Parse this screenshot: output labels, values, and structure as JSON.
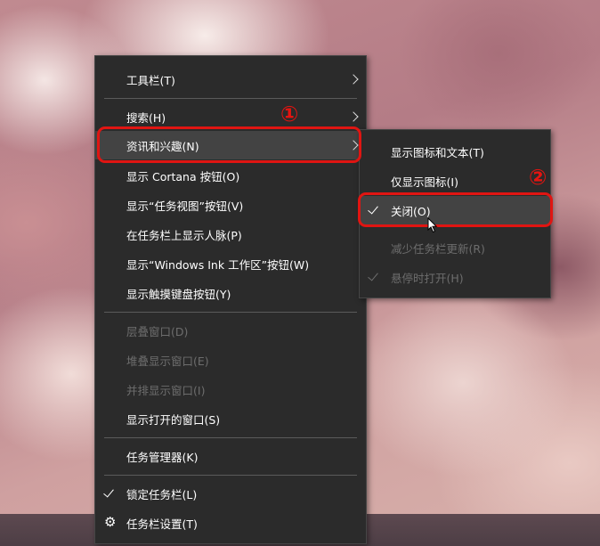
{
  "main_menu": {
    "toolbars": "工具栏(T)",
    "search": "搜索(H)",
    "news_interests": "资讯和兴趣(N)",
    "show_cortana": "显示 Cortana 按钮(O)",
    "show_task_view": "显示“任务视图”按钮(V)",
    "show_people": "在任务栏上显示人脉(P)",
    "show_ink": "显示“Windows Ink 工作区”按钮(W)",
    "show_touch_keyboard": "显示触摸键盘按钮(Y)",
    "cascade": "层叠窗口(D)",
    "stack": "堆叠显示窗口(E)",
    "side_by_side": "并排显示窗口(I)",
    "show_desktop": "显示打开的窗口(S)",
    "task_manager": "任务管理器(K)",
    "lock_taskbar": "锁定任务栏(L)",
    "taskbar_settings": "任务栏设置(T)"
  },
  "sub_menu": {
    "show_icon_text": "显示图标和文本(T)",
    "show_icon_only": "仅显示图标(I)",
    "turn_off": "关闭(O)",
    "reduce_updates": "减少任务栏更新(R)",
    "open_on_hover": "悬停时打开(H)"
  },
  "annotations": {
    "step1": "①",
    "step2": "②"
  },
  "icons": {
    "submenu_arrow": "chevron-right-icon",
    "check": "checkmark-icon",
    "settings": "gear-icon",
    "pointer": "mouse-cursor-icon"
  },
  "colors": {
    "menu_bg": "#2b2b2b",
    "hover_bg": "#434343",
    "annotation_red": "#e01512",
    "disabled_text": "#6d6d6d"
  }
}
